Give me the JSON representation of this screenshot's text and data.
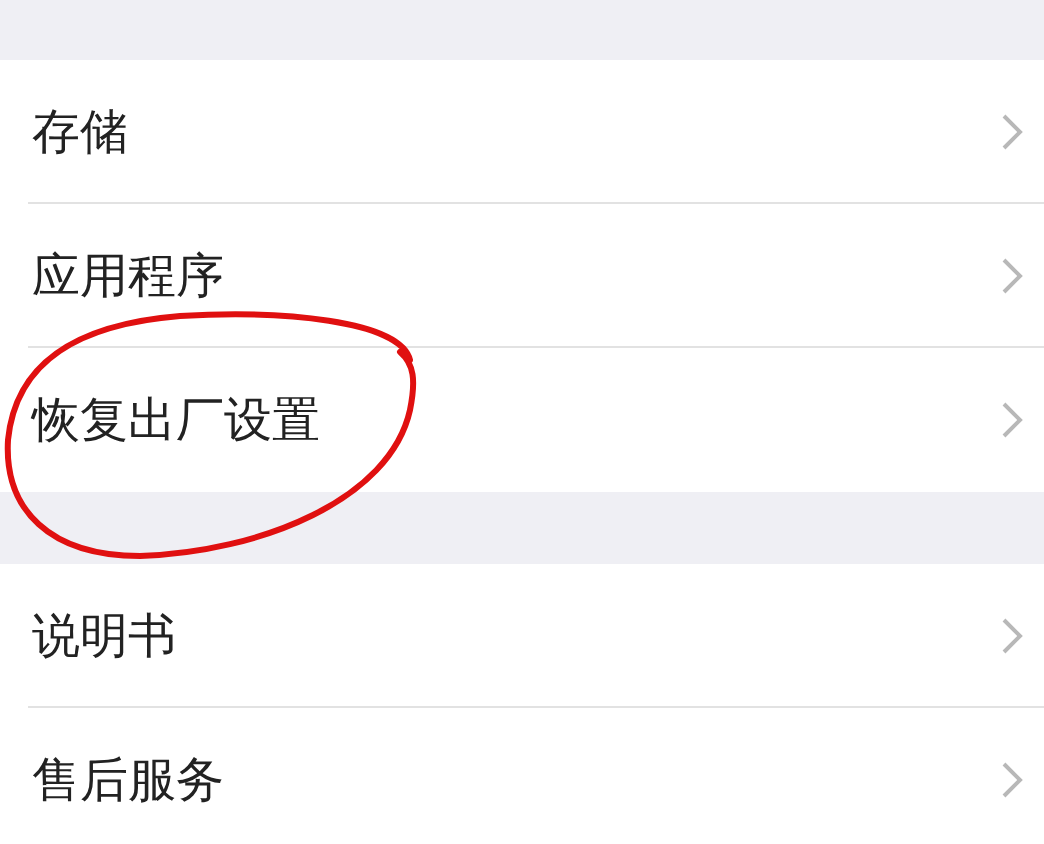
{
  "groups": [
    {
      "items": [
        {
          "label": "存储"
        },
        {
          "label": "应用程序"
        },
        {
          "label": "恢复出厂设置"
        }
      ]
    },
    {
      "items": [
        {
          "label": "说明书"
        },
        {
          "label": "售后服务"
        }
      ]
    }
  ]
}
